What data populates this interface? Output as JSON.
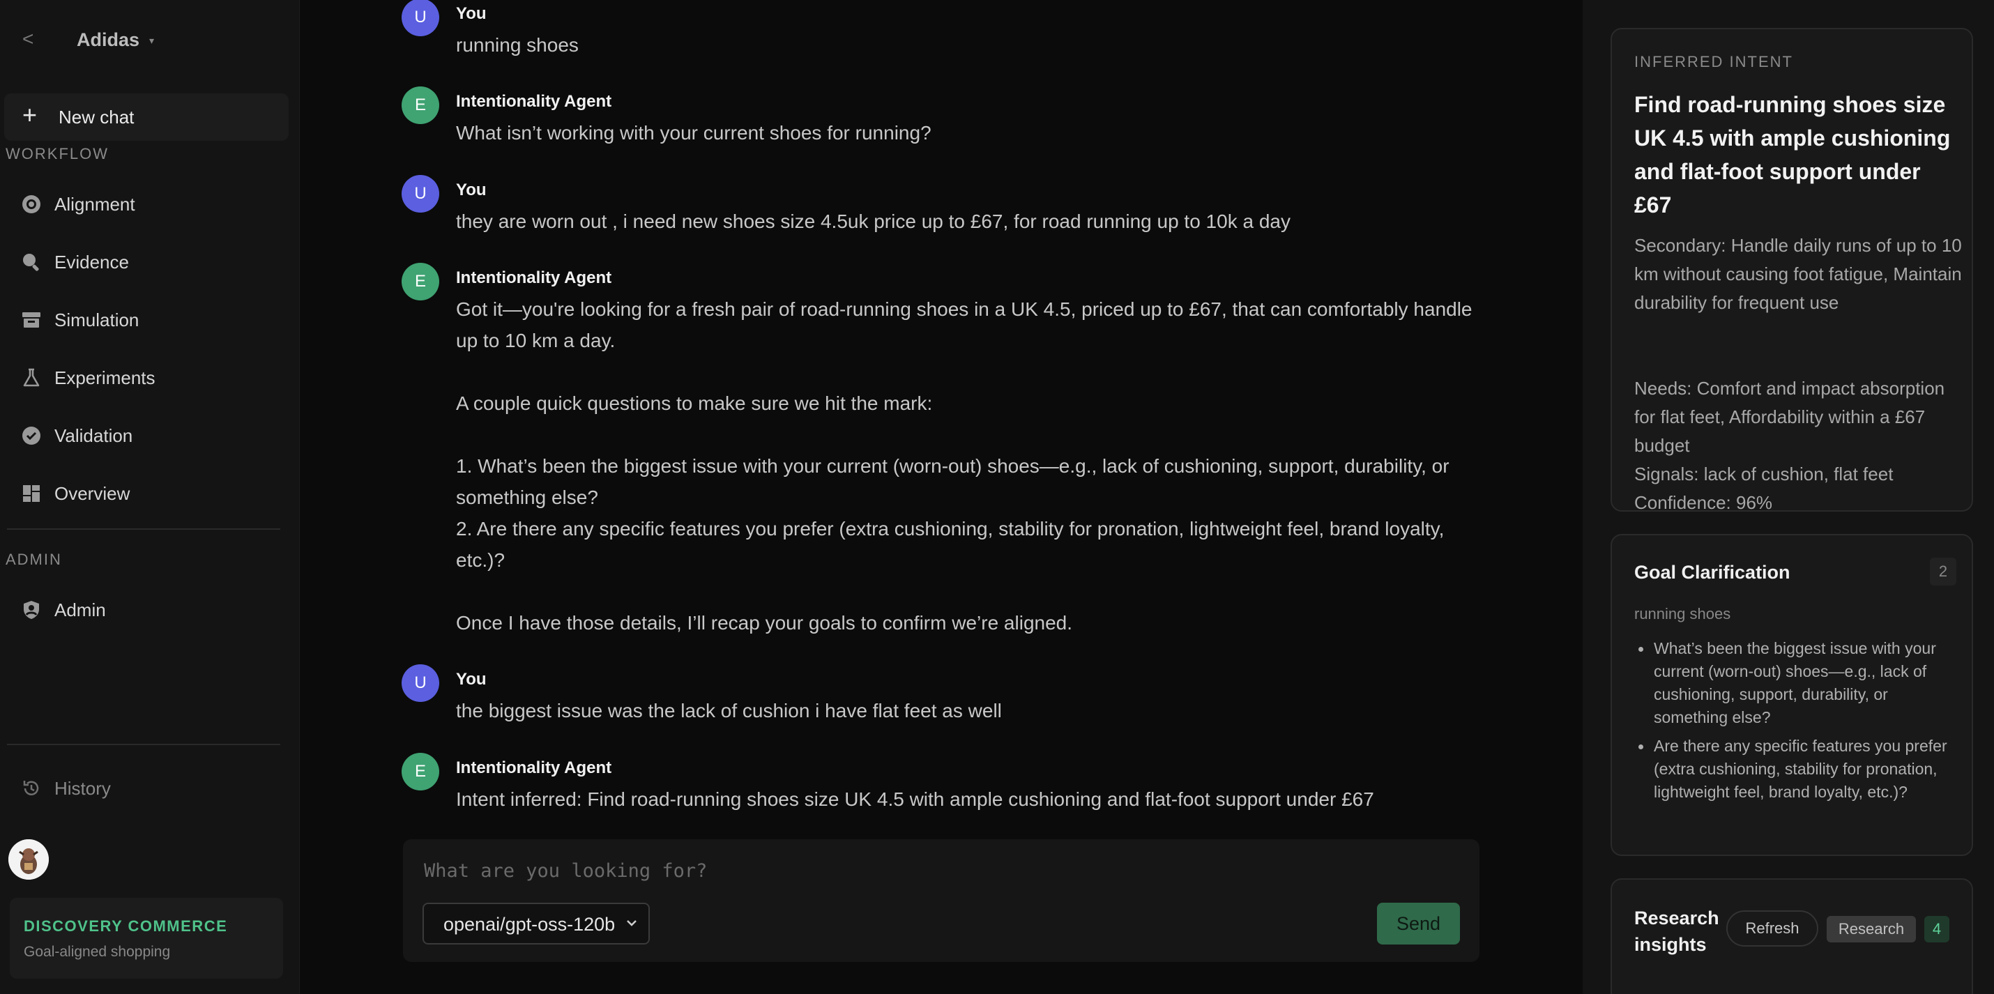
{
  "sidebar": {
    "back": "<",
    "brand": "Adidas",
    "brand_caret": "▾",
    "new_chat": "New chat",
    "workflow_label": "WORKFLOW",
    "items": [
      {
        "label": "Alignment",
        "icon": "target-icon"
      },
      {
        "label": "Evidence",
        "icon": "search-icon"
      },
      {
        "label": "Simulation",
        "icon": "archive-icon"
      },
      {
        "label": "Experiments",
        "icon": "flask-icon"
      },
      {
        "label": "Validation",
        "icon": "check-circle-icon"
      },
      {
        "label": "Overview",
        "icon": "dashboard-icon"
      }
    ],
    "admin_label": "ADMIN",
    "admin_item": "Admin",
    "history": "History",
    "discovery_title": "DISCOVERY COMMERCE",
    "discovery_sub": "Goal-aligned shopping"
  },
  "chat": {
    "messages": [
      {
        "avatar": "U",
        "name": "You",
        "text": "running shoes"
      },
      {
        "avatar": "E",
        "name": "Intentionality Agent",
        "text": "What isn’t working with your current shoes for running?"
      },
      {
        "avatar": "U",
        "name": "You",
        "text": "they are worn out , i need new shoes size 4.5uk price up to £67, for road running up to 10k a day"
      },
      {
        "avatar": "E",
        "name": "Intentionality Agent",
        "paragraphs": [
          "Got it—you're looking for a fresh pair of road-running shoes in a UK 4.5, priced up to £67, that can comfortably handle up to 10 km a day.",
          "A couple quick questions to make sure we hit the mark:",
          "1. What’s been the biggest issue with your current (worn-out) shoes—e.g., lack of cushioning, support, durability, or something else?\n2. Are there any specific features you prefer (extra cushioning, stability for pronation, lightweight feel, brand loyalty, etc.)?",
          "Once I have those details, I’ll recap your goals to confirm we’re aligned."
        ]
      },
      {
        "avatar": "U",
        "name": "You",
        "text": "the biggest issue was the lack of cushion i have flat feet as well"
      },
      {
        "avatar": "E",
        "name": "Intentionality Agent",
        "text": "Intent inferred: Find road-running shoes size UK 4.5 with ample cushioning and flat-foot support under £67"
      }
    ],
    "composer": {
      "placeholder": "What are you looking for?",
      "model": "openai/gpt-oss-120b",
      "send": "Send"
    }
  },
  "panel": {
    "intent": {
      "label": "INFERRED INTENT",
      "title": "Find road-running shoes size UK 4.5 with ample cushioning and flat-foot support under £67",
      "secondary": "Secondary: Handle daily runs of up to 10 km without causing foot fatigue, Maintain durability for frequent use",
      "needs": "Needs: Comfort and impact absorption for flat feet, Affordability within a £67 budget",
      "signals": "Signals: lack of cushion, flat feet",
      "confidence": "Confidence: 96%"
    },
    "goal": {
      "title": "Goal Clarification",
      "count": "2",
      "subtitle": "running shoes",
      "items": [
        "What’s been the biggest issue with your current (worn-out) shoes—e.g., lack of cushioning, support, durability, or something else?",
        "Are there any specific features you prefer (extra cushioning, stability for pronation, lightweight feel, brand loyalty, etc.)?"
      ]
    },
    "research": {
      "title": "Research insights",
      "refresh": "Refresh",
      "research": "Research",
      "count": "4"
    }
  },
  "colors": {
    "user_avatar": "#5b5fe0",
    "agent_avatar": "#3fa372",
    "accent_green": "#4fc28a",
    "send_button": "#2f6a4a"
  }
}
